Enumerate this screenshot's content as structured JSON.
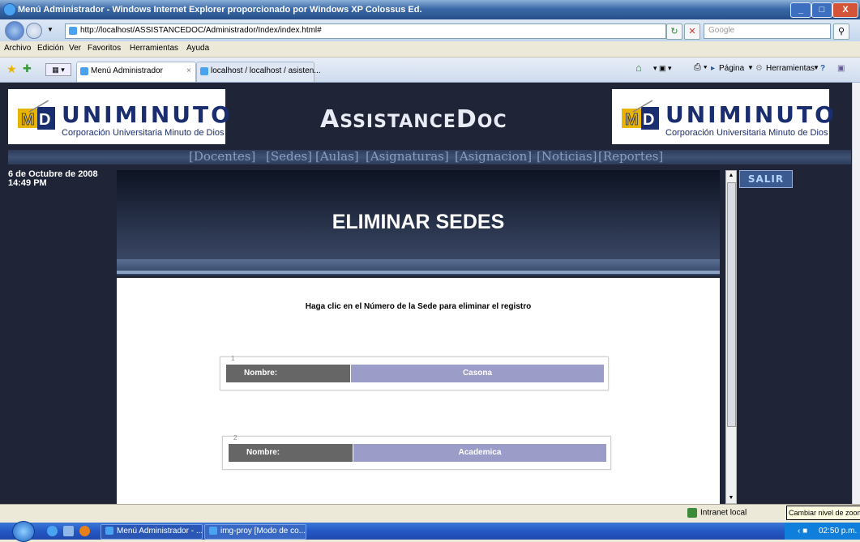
{
  "window": {
    "title": "Menú Administrador - Windows Internet Explorer proporcionado por Windows XP Colossus Ed.",
    "controls": [
      "_",
      "□",
      "X"
    ]
  },
  "addressbar": {
    "url": "http://localhost/ASSISTANCEDOC/Administrador/Index/index.html#",
    "search_placeholder": "Google",
    "refresh_glyph": "↻",
    "stop_glyph": "✕"
  },
  "menubar": {
    "items": [
      "Archivo",
      "Edición",
      "Ver",
      "Favoritos",
      "Herramientas",
      "Ayuda"
    ]
  },
  "tabs": [
    {
      "label": "Menú Administrador",
      "close": "×"
    },
    {
      "label": "localhost / localhost / asisten..."
    }
  ],
  "commandbar": {
    "pagina": "Página",
    "herramientas": "Herramientas"
  },
  "page": {
    "logo_text": "UNIMINUTO",
    "logo_subtitle": "Corporación Universitaria Minuto de Dios",
    "brand_a": "A",
    "brand_b": "SSISTANCE",
    "brand_c": "D",
    "brand_d": "OC",
    "nav": [
      "[Docentes]",
      "[Sedes]",
      "[Aulas]",
      "[Asignaturas]",
      "[Asignacion]",
      "[Noticias]",
      "[Reportes]"
    ],
    "date_line1": "6 de Octubre de 2008",
    "date_line2": "14:49 PM",
    "heading": "ELIMINAR SEDES",
    "instruction": "Haga clic en el Número de la Sede para eliminar el registro",
    "records": [
      {
        "number": "1",
        "label": "Nombre:",
        "value": "Casona"
      },
      {
        "number": "2",
        "label": "Nombre:",
        "value": "Academica"
      }
    ],
    "salir_label": "SALIR"
  },
  "statusbar": {
    "zone": "Intranet local",
    "tooltip": "Cambiar nivel de zoom"
  },
  "taskbar": {
    "tasks": [
      "Menú Administrador - ...",
      "img-proy [Modo de co..."
    ],
    "clock": "02:50 p.m."
  }
}
